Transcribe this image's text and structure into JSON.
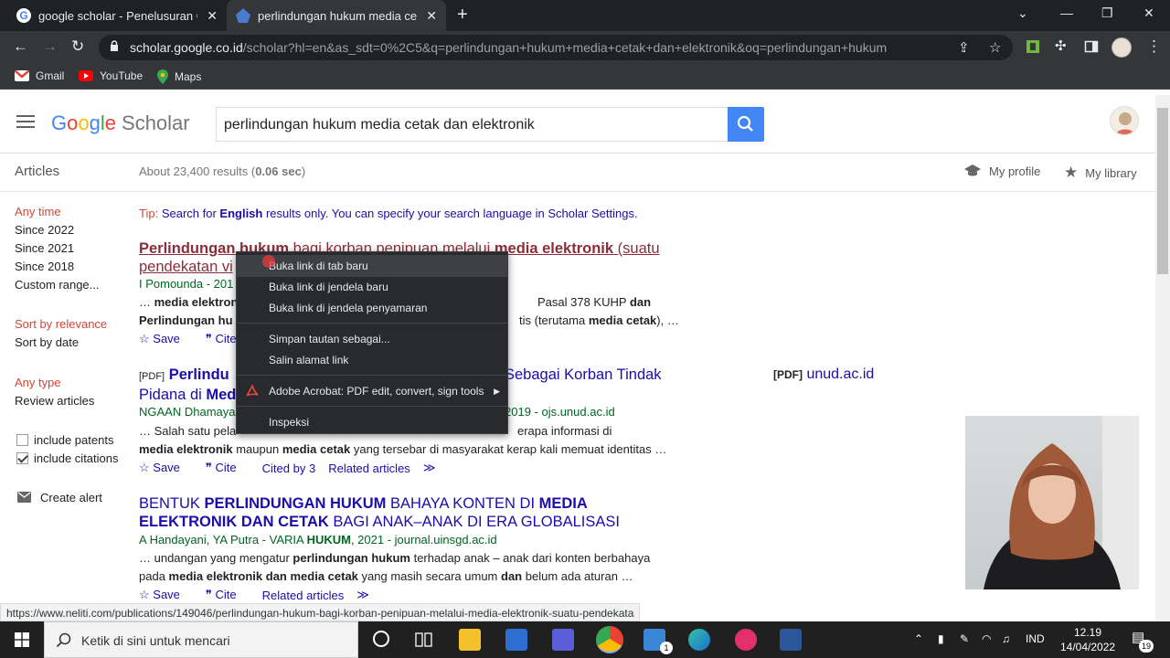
{
  "browser": {
    "tabs": [
      {
        "title": "google scholar - Penelusuran Google",
        "active": false
      },
      {
        "title": "perlindungan hukum media cetak",
        "active": true
      }
    ],
    "url_host": "scholar.google.co.id",
    "url_path": "/scholar?hl=en&as_sdt=0%2C5&q=perlindungan+hukum+media+cetak+dan+elektronik&oq=perlindungan+hukum",
    "bookmarks": [
      "Gmail",
      "YouTube",
      "Maps"
    ]
  },
  "scholar": {
    "logo_google": "Google",
    "logo_scholar": "Scholar",
    "query": "perlindungan hukum media cetak dan elektronik",
    "articles_label": "Articles",
    "stats_prefix": "About 23,400 results (",
    "stats_time": "0.06 sec",
    "stats_suffix": ")",
    "my_profile": "My profile",
    "my_library": "My library"
  },
  "leftnav": {
    "time": [
      "Any time",
      "Since 2022",
      "Since 2021",
      "Since 2018",
      "Custom range..."
    ],
    "sort": [
      "Sort by relevance",
      "Sort by date"
    ],
    "type": [
      "Any type",
      "Review articles"
    ],
    "include_patents": "include patents",
    "include_citations": "include citations",
    "create_alert": "Create alert"
  },
  "tip": {
    "label": "Tip:",
    "text1": " Search for ",
    "bold": "English",
    "text2": " results only. You can specify your search language in ",
    "link": "Scholar Settings",
    "text3": "."
  },
  "results": [
    {
      "title_line1_a": "Perlindungan hukum",
      "title_line1_b": " bagi korban penipuan melalui ",
      "title_line1_c": "media elektronik",
      "title_line1_d": " (suatu",
      "title_line2": "pendekatan vi",
      "meta": "I Pomounda - 201",
      "snip1_a": "… ",
      "snip1_b": "media elektron",
      "snip1_c": "Pasal 378 KUHP ",
      "snip1_d": "dan",
      "snip2_a": "Perlindungan hu",
      "snip2_b": "tis (terutama ",
      "snip2_c": "media cetak",
      "snip2_d": "), …",
      "save": "Save",
      "cite": "Cite"
    },
    {
      "pdf_tag": "[PDF]",
      "title_line1_a": "Perlindu",
      "title_line1_b": "Sebagai Korban Tindak",
      "title_line2_a": "Pidana di ",
      "title_line2_b": "Med",
      "meta_a": "NGAAN Dhamaya",
      "meta_b": "2019 - ojs.unud.ac.id",
      "snip1_a": "… Salah satu pela",
      "snip1_b": "erapa informasi di",
      "snip2_a": "media elektronik",
      "snip2_b": " maupun ",
      "snip2_c": "media cetak",
      "snip2_d": " yang tersebar di masyarakat kerap kali memuat identitas …",
      "save": "Save",
      "cite": "Cite",
      "cited_by": "Cited by 3",
      "related": "Related articles",
      "side_pdf_tag": "[PDF]",
      "side_pdf_host": "unud.ac.id"
    },
    {
      "title_line1_a": "BENTUK ",
      "title_line1_b": "PERLINDUNGAN HUKUM",
      "title_line1_c": " BAHAYA KONTEN DI ",
      "title_line1_d": "MEDIA",
      "title_line2_a": "ELEKTRONIK DAN CETAK",
      "title_line2_b": " BAGI ANAK–ANAK DI ERA GLOBALISASI",
      "meta_a": "A Handayani, YA Putra - VARIA ",
      "meta_b": "HUKUM",
      "meta_c": ", 2021 - journal.uinsgd.ac.id",
      "snip1_a": "… undangan yang mengatur ",
      "snip1_b": "perlindungan hukum",
      "snip1_c": " terhadap anak – anak dari konten berbahaya",
      "snip2_a": "pada ",
      "snip2_b": "media elektronik dan media cetak",
      "snip2_c": " yang masih secara umum ",
      "snip2_d": "dan",
      "snip2_e": " belum ada aturan …",
      "save": "Save",
      "cite": "Cite",
      "related": "Related articles"
    }
  ],
  "context_menu": {
    "items": [
      "Buka link di tab baru",
      "Buka link di jendela baru",
      "Buka link di jendela penyamaran",
      "Simpan tautan sebagai...",
      "Salin alamat link",
      "Adobe Acrobat: PDF edit, convert, sign tools",
      "Inspeksi"
    ]
  },
  "status_url": "https://www.neliti.com/publications/149046/perlindungan-hukum-bagi-korban-penipuan-melalui-media-elektronik-suatu-pendekata",
  "taskbar": {
    "search_placeholder": "Ketik di sini untuk mencari",
    "lang": "IND",
    "time": "12.19",
    "date": "14/04/2022",
    "notif_count": "19",
    "mail_badge": "1"
  },
  "colors": {
    "link": "#1a0dab",
    "visited": "#8c2e39",
    "meta_green": "#006621",
    "accent_red": "#d14836",
    "search_blue": "#4285f4"
  }
}
